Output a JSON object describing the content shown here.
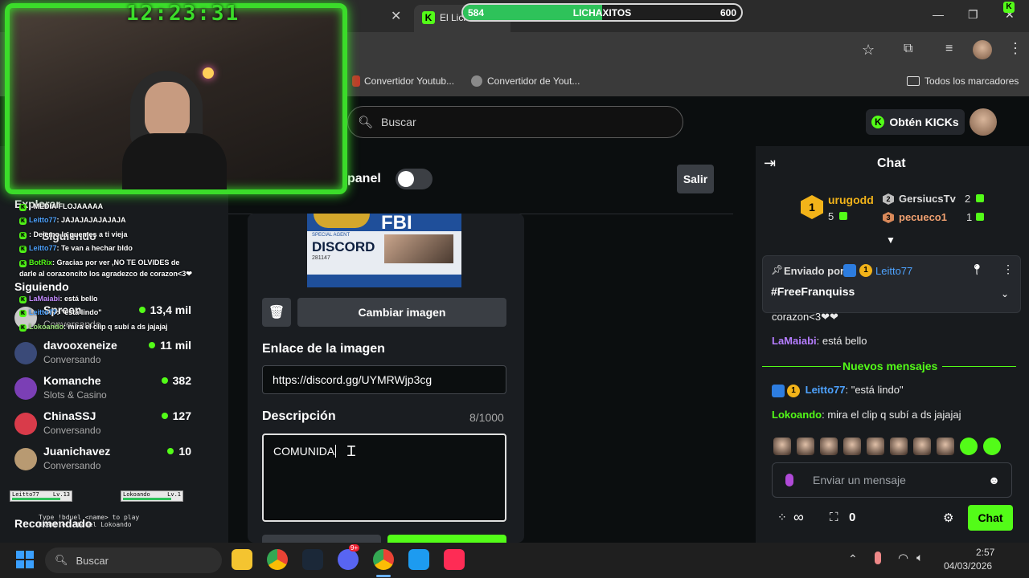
{
  "browser": {
    "tab_title": "El Lich",
    "bookmarks": [
      "Convertidor Youtub...",
      "Convertidor de Yout...",
      "Todos los marcadores"
    ]
  },
  "xp_bar": {
    "min": "584",
    "label": "LICHAXITOS",
    "max": "600",
    "progress": 0.5
  },
  "webcam": {
    "clock": "12:23:31"
  },
  "header": {
    "search_placeholder": "Buscar",
    "get_kicks": "Obtén KICKs"
  },
  "sidebar": {
    "explore_label": "Explorar",
    "following_label": "Siguiendo",
    "following_heading": "Siguiendo",
    "recommended_label": "Recomendado",
    "channels": [
      {
        "name": "Spreen",
        "category": "Conversando",
        "viewers": "13,4 mil",
        "color": "#c9c9c9"
      },
      {
        "name": "davooxeneize",
        "category": "Conversando",
        "viewers": "11 mil",
        "color": "#3a4a78"
      },
      {
        "name": "Komanche",
        "category": "Slots & Casino",
        "viewers": "382",
        "color": "#7b3fb5"
      },
      {
        "name": "ChinaSSJ",
        "category": "Conversando",
        "viewers": "127",
        "color": "#d93b4a"
      },
      {
        "name": "Juanichavez",
        "category": "Conversando",
        "viewers": "10",
        "color": "#b89a72"
      }
    ]
  },
  "overlay_chat": [
    {
      "user": "",
      "text": ": MEDIA FLOJAAAAA"
    },
    {
      "user": "Leitto77",
      "text": ": JAJAJAJAJAJAJA"
    },
    {
      "user": "",
      "text": ": Dejemo la quemes a ti vieja"
    },
    {
      "user": "Leitto77",
      "text": ": Te van a hechar bldo"
    },
    {
      "user": "BotRix",
      "text": ": Gracias por ver ,NO TE OLVIDES de"
    },
    {
      "user": "",
      "text": "darle al corazoncito los agradezco de corazon<3❤"
    },
    {
      "user": "LaMaiabi",
      "text": ": está bello"
    },
    {
      "user": "Leitto77",
      "text": ": \"está lindo\""
    },
    {
      "user": "Lokoando",
      "text": ": mira el clip q subí a ds jajajaj"
    }
  ],
  "duel": {
    "player1": "Leitto77",
    "player1_lvl": "Lv.13",
    "player2": "Lokoando",
    "player2_lvl": "Lv.1",
    "hint1": "Type !bduel <name> to play",
    "hint2": "Example: !bduel Lokoando"
  },
  "panel": {
    "title": "panel",
    "exit_button": "Salir",
    "change_image_button": "Cambiar imagen",
    "image_link_label": "Enlace de la imagen",
    "image_link_value": "https://discord.gg/UYMRWjp3cg",
    "description_label": "Descripción",
    "description_count": "8/1000",
    "description_value": "COMUNIDA",
    "fbi_card": {
      "header": "FBI",
      "text": "DISCORD",
      "agent": "SPECIAL AGENT",
      "number": "281147"
    }
  },
  "chat": {
    "title": "Chat",
    "top_gifters": [
      {
        "rank": "1",
        "name": "urugodd",
        "count": "5"
      },
      {
        "rank": "2",
        "name": "GersiucsTv",
        "count": "2"
      },
      {
        "rank": "3",
        "name": "pecueco1",
        "count": "1"
      }
    ],
    "pinned": {
      "sent_by": "Enviado por",
      "user": "Leitto77",
      "text": "#FreeFranquiss"
    },
    "messages": [
      {
        "user": "",
        "text": "corazon<3❤❤"
      },
      {
        "user": "LaMaiabi",
        "text": "está bello"
      }
    ],
    "new_messages": "Nuevos mensajes",
    "messages_new": [
      {
        "user": "Leitto77",
        "text": "\"está lindo\""
      },
      {
        "user": "Lokoando",
        "text": "mira el clip q subí a ds jajajaj"
      }
    ],
    "input_placeholder": "Enviar un mensaje",
    "points": "∞",
    "gifts_count": "0",
    "send_button": "Chat"
  },
  "taskbar": {
    "search_text": "Buscar",
    "time": "2:57",
    "date": "04/03/2026",
    "discord_badge": "9+"
  },
  "colors": {
    "kick_green": "#53fc18",
    "webcam_border": "#3bdc2a",
    "panel_bg": "#1a1d21"
  }
}
